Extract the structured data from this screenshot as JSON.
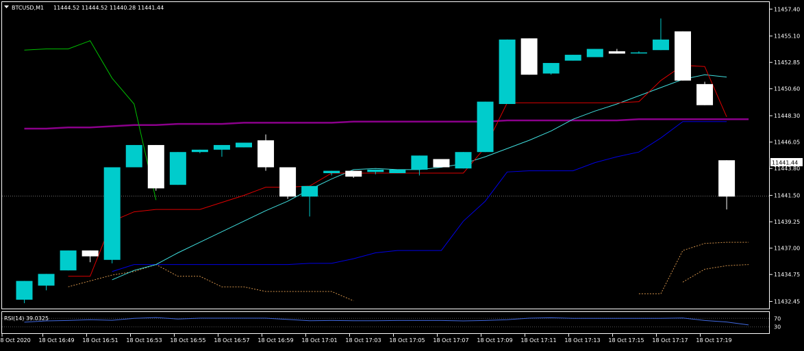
{
  "colors": {
    "background": "#000000",
    "frame": "#ffffff",
    "grid": "#5a5a5a",
    "bull": "#00cccc",
    "bear": "#ffffff",
    "cyan_ma": "#40e0e0",
    "red_ma": "#e00000",
    "green_ma": "#00c000",
    "purple_ma": "#8b008b",
    "blue_line": "#0000e6",
    "orange_dotted": "#d2924a",
    "rsi_line": "#4169e1",
    "price_tag_bg": "#ffffff",
    "price_tag_text": "#000000"
  },
  "header": {
    "arrow_icon": "triangle-down-icon",
    "symbol": "BTCUSD,M1",
    "open": "11444.52",
    "high": "11444.52",
    "low": "11440.28",
    "close": "11441.44"
  },
  "current_price_label": "11441.44",
  "rsi_label": "RSI(14) 39.0325",
  "chart_data": [
    {
      "type": "candlestick",
      "title": "BTCUSD,M1",
      "y_ticks": [
        "11457.40",
        "11455.10",
        "11452.85",
        "11450.60",
        "11448.30",
        "11446.05",
        "11443.80",
        "11441.50",
        "11439.25",
        "11437.00",
        "11434.75",
        "11432.45"
      ],
      "ylim": [
        11431.9,
        11458.0
      ],
      "x_ticks": [
        "18 Oct 2020",
        "18 Oct 16:49",
        "18 Oct 16:51",
        "18 Oct 16:53",
        "18 Oct 16:55",
        "18 Oct 16:57",
        "18 Oct 16:59",
        "18 Oct 17:01",
        "18 Oct 17:03",
        "18 Oct 17:05",
        "18 Oct 17:07",
        "18 Oct 17:09",
        "18 Oct 17:11",
        "18 Oct 17:13",
        "18 Oct 17:15",
        "18 Oct 17:17",
        "18 Oct 17:19"
      ],
      "candles": [
        {
          "o": 11432.6,
          "h": 11434.2,
          "l": 11432.3,
          "c": 11434.2
        },
        {
          "o": 11433.8,
          "h": 11434.8,
          "l": 11433.4,
          "c": 11434.8
        },
        {
          "o": 11435.1,
          "h": 11436.8,
          "l": 11435.1,
          "c": 11436.8
        },
        {
          "o": 11436.8,
          "h": 11436.8,
          "l": 11435.8,
          "c": 11436.3
        },
        {
          "o": 11436.0,
          "h": 11443.9,
          "l": 11435.7,
          "c": 11443.9
        },
        {
          "o": 11443.9,
          "h": 11445.8,
          "l": 11443.9,
          "c": 11445.8
        },
        {
          "o": 11445.8,
          "h": 11445.8,
          "l": 11441.9,
          "c": 11442.1
        },
        {
          "o": 11442.4,
          "h": 11445.2,
          "l": 11442.4,
          "c": 11445.2
        },
        {
          "o": 11445.2,
          "h": 11445.4,
          "l": 11445.1,
          "c": 11445.4
        },
        {
          "o": 11445.4,
          "h": 11445.8,
          "l": 11444.8,
          "c": 11445.8
        },
        {
          "o": 11445.6,
          "h": 11446.0,
          "l": 11445.6,
          "c": 11446.0
        },
        {
          "o": 11446.2,
          "h": 11446.7,
          "l": 11443.6,
          "c": 11443.9
        },
        {
          "o": 11443.9,
          "h": 11443.9,
          "l": 11441.2,
          "c": 11441.4
        },
        {
          "o": 11441.4,
          "h": 11442.1,
          "l": 11439.7,
          "c": 11442.3
        },
        {
          "o": 11443.4,
          "h": 11443.6,
          "l": 11443.2,
          "c": 11443.6
        },
        {
          "o": 11443.6,
          "h": 11443.6,
          "l": 11443.0,
          "c": 11443.1
        },
        {
          "o": 11443.5,
          "h": 11443.7,
          "l": 11443.3,
          "c": 11443.7
        },
        {
          "o": 11443.4,
          "h": 11443.7,
          "l": 11443.4,
          "c": 11443.7
        },
        {
          "o": 11443.7,
          "h": 11444.9,
          "l": 11443.2,
          "c": 11444.9
        },
        {
          "o": 11444.6,
          "h": 11444.6,
          "l": 11443.9,
          "c": 11443.9
        },
        {
          "o": 11443.8,
          "h": 11445.2,
          "l": 11443.8,
          "c": 11445.2
        },
        {
          "o": 11445.2,
          "h": 11449.5,
          "l": 11445.2,
          "c": 11449.5
        },
        {
          "o": 11449.3,
          "h": 11454.8,
          "l": 11449.3,
          "c": 11454.8
        },
        {
          "o": 11454.9,
          "h": 11454.9,
          "l": 11451.8,
          "c": 11451.8
        },
        {
          "o": 11451.9,
          "h": 11452.8,
          "l": 11451.8,
          "c": 11452.8
        },
        {
          "o": 11453.0,
          "h": 11453.5,
          "l": 11453.0,
          "c": 11453.5
        },
        {
          "o": 11453.3,
          "h": 11454.0,
          "l": 11453.3,
          "c": 11454.0
        },
        {
          "o": 11453.8,
          "h": 11454.0,
          "l": 11453.6,
          "c": 11453.6
        },
        {
          "o": 11453.7,
          "h": 11453.8,
          "l": 11453.6,
          "c": 11453.7
        },
        {
          "o": 11453.9,
          "h": 11456.6,
          "l": 11453.9,
          "c": 11454.8
        },
        {
          "o": 11455.5,
          "h": 11455.5,
          "l": 11451.3,
          "c": 11451.3
        },
        {
          "o": 11451.0,
          "h": 11451.2,
          "l": 11449.2,
          "c": 11449.2
        },
        {
          "o": 11444.5,
          "h": 11444.5,
          "l": 11440.3,
          "c": 11441.4
        }
      ],
      "cyan_ma": [
        null,
        null,
        null,
        null,
        11434.3,
        11435.1,
        11435.6,
        11436.6,
        11437.5,
        11438.4,
        11439.3,
        11440.2,
        11441.0,
        11442.0,
        11442.9,
        11443.7,
        11443.8,
        11443.7,
        11443.7,
        11443.9,
        11444.2,
        11444.8,
        11445.5,
        11446.2,
        11447.0,
        11448.0,
        11448.7,
        11449.3,
        11450.0,
        11450.7,
        11451.4,
        11451.8,
        11451.6
      ],
      "red_ma": [
        null,
        null,
        11434.6,
        11434.6,
        11439.3,
        11440.1,
        11440.3,
        11440.3,
        11440.3,
        11440.9,
        11441.5,
        11442.2,
        11442.2,
        11442.3,
        11443.4,
        11443.4,
        11443.4,
        11443.4,
        11443.4,
        11443.4,
        11443.4,
        11445.6,
        11449.4,
        11449.4,
        11449.4,
        11449.4,
        11449.4,
        11449.4,
        11449.5,
        11451.3,
        11452.6,
        11452.5,
        11448.2
      ],
      "green_ma": [
        11453.9,
        11454.0,
        11454.0,
        11454.7,
        11451.5,
        11449.3,
        11441.1,
        null,
        null,
        null,
        null,
        null,
        null,
        null,
        null,
        null,
        null,
        null,
        null,
        null,
        null,
        null,
        null,
        null,
        null,
        null,
        null,
        null,
        null,
        null,
        null,
        null,
        null
      ],
      "purple_ma": [
        11447.2,
        11447.2,
        11447.3,
        11447.3,
        11447.4,
        11447.5,
        11447.5,
        11447.6,
        11447.6,
        11447.6,
        11447.7,
        11447.7,
        11447.7,
        11447.7,
        11447.7,
        11447.8,
        11447.8,
        11447.8,
        11447.8,
        11447.8,
        11447.8,
        11447.8,
        11447.9,
        11447.9,
        11447.9,
        11447.9,
        11447.9,
        11447.9,
        11448.0,
        11448.0,
        11448.0,
        11448.0,
        11448.0,
        11448.0
      ],
      "blue_line": [
        null,
        null,
        null,
        null,
        11435.0,
        11435.6,
        11435.6,
        11435.6,
        11435.6,
        11435.6,
        11435.6,
        11435.6,
        11435.6,
        11435.7,
        11435.7,
        11436.1,
        11436.6,
        11436.8,
        11436.8,
        11436.8,
        11439.3,
        11441.0,
        11443.5,
        11443.6,
        11443.6,
        11443.6,
        11444.3,
        11444.8,
        11445.2,
        11446.4,
        11447.8,
        11447.8,
        11447.8
      ],
      "orange_upper": [
        null,
        null,
        11433.7,
        11434.2,
        11434.7,
        11435.0,
        11435.6,
        11434.6,
        11434.6,
        11433.7,
        11433.7,
        11433.3,
        11433.3,
        11433.3,
        11433.3,
        11432.5,
        null,
        null,
        null,
        null,
        null,
        null,
        null,
        null,
        null,
        null,
        null,
        null,
        11433.1,
        11433.1,
        11436.8,
        11437.4,
        11437.5,
        11437.5
      ],
      "orange_lower": [
        null,
        null,
        null,
        null,
        null,
        null,
        null,
        null,
        null,
        null,
        null,
        null,
        null,
        null,
        null,
        null,
        null,
        null,
        null,
        null,
        null,
        null,
        null,
        null,
        null,
        null,
        null,
        null,
        null,
        null,
        11434.1,
        11435.2,
        11435.5,
        11435.6
      ]
    },
    {
      "type": "line",
      "title": "RSI(14) 39.0325",
      "y_ticks": [
        "70",
        "30"
      ],
      "ylim": [
        0,
        100
      ],
      "series": [
        {
          "values": [
            52,
            58,
            60,
            64,
            61,
            70,
            74,
            67,
            71,
            71,
            71,
            71,
            65,
            59,
            60,
            59,
            59,
            60,
            60,
            60,
            58,
            60,
            64,
            71,
            73,
            70,
            70,
            70,
            70,
            70,
            72,
            60,
            53,
            39
          ]
        }
      ]
    }
  ]
}
